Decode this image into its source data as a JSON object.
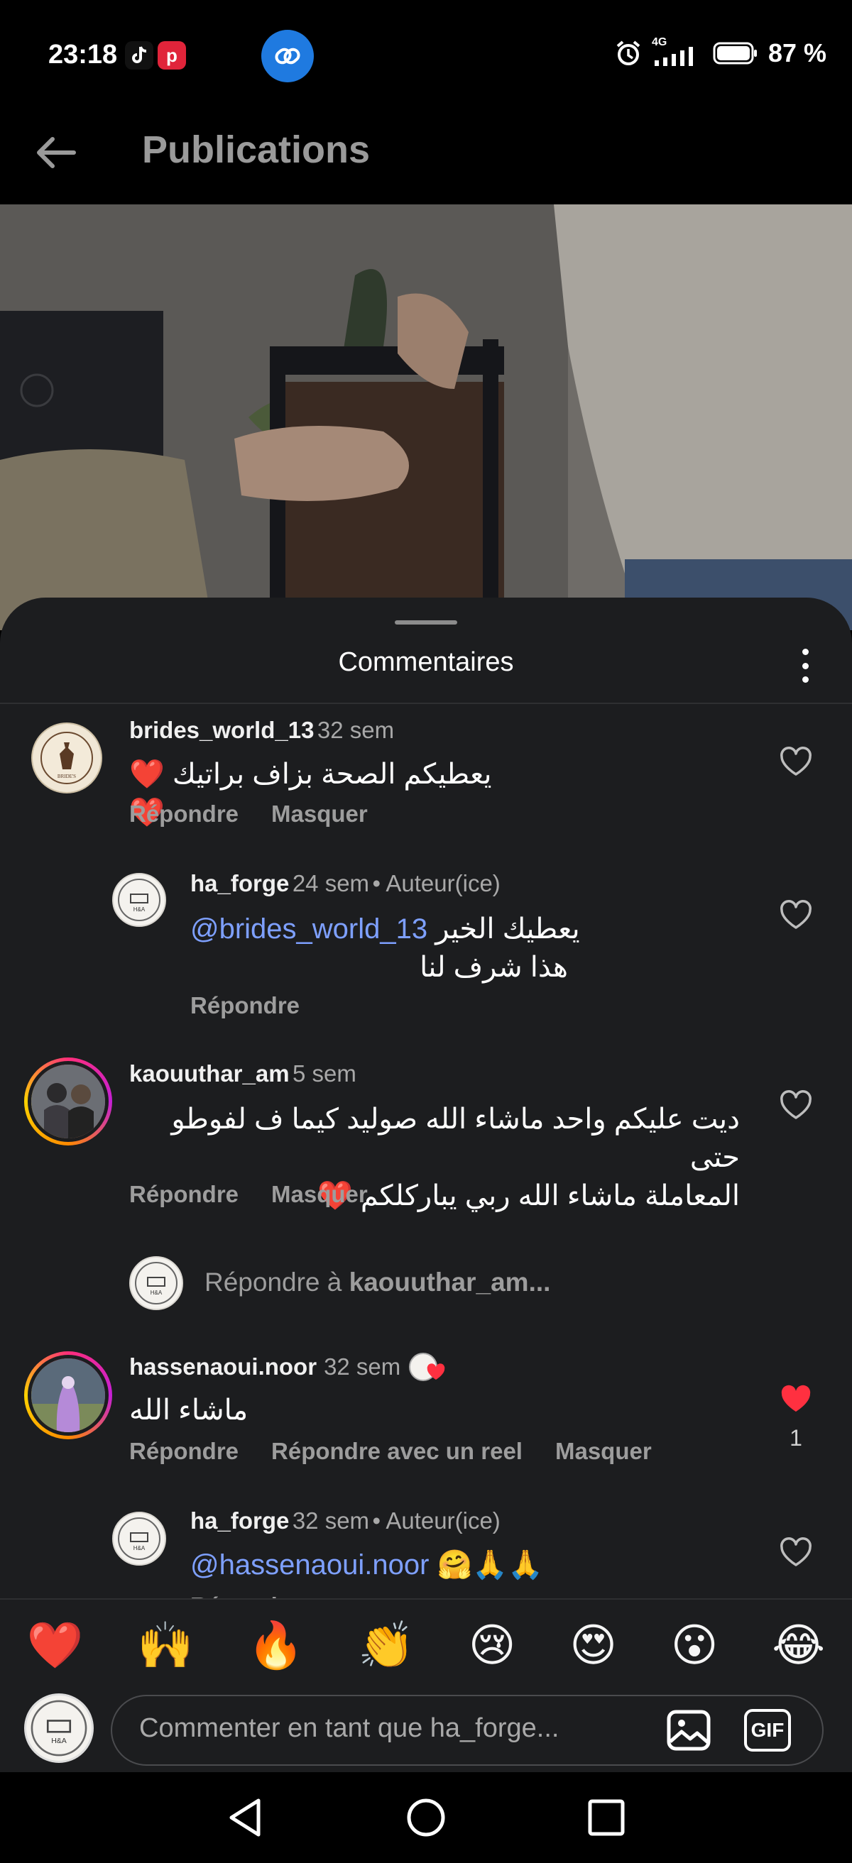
{
  "status_bar": {
    "time": "23:18",
    "network": "4G",
    "battery": "87 %",
    "icons": [
      "tiktok-icon",
      "red-app-icon",
      "link-icon",
      "alarm-icon",
      "signal-icon",
      "battery-icon"
    ]
  },
  "header": {
    "title": "Publications",
    "back_icon": "arrow-left-icon"
  },
  "sheet": {
    "title": "Commentaires",
    "menu_icon": "more-vertical-icon"
  },
  "comments": [
    {
      "username": "brides_world_13",
      "time": "32 sem",
      "text": "يعطيكم الصحة بزاف براتيك ❤️❤️",
      "actions": [
        "Répondre",
        "Masquer"
      ]
    },
    {
      "username": "ha_forge",
      "time": "24 sem",
      "author_badge": "• Auteur(ice)",
      "mention": "@brides_world_13",
      "text_line1": "يعطيك الخير",
      "text_line2": "هذا شرف لنا",
      "actions": [
        "Répondre"
      ]
    },
    {
      "username": "kaouuthar_am",
      "time": "5 sem",
      "text_line1": "ديت عليكم واحد ماشاء الله صوليد كيما ف لفوطو حتى",
      "text_line2": "المعاملة ماشاء الله ربي يباركلكم ❤️",
      "actions": [
        "Répondre",
        "Masquer"
      ]
    },
    {
      "username": "hassenaoui.noor",
      "time": "32 sem",
      "text": "ماشاء الله",
      "likes": "1",
      "actions": [
        "Répondre",
        "Répondre avec un reel",
        "Masquer"
      ]
    },
    {
      "username": "ha_forge",
      "time": "32 sem",
      "author_badge": "• Auteur(ice)",
      "mention": "@hassenaoui.noor",
      "text": "🤗🙏🙏",
      "actions": [
        "Répondre"
      ]
    }
  ],
  "reply_prompt": {
    "prefix": "Répondre à ",
    "username": "kaouuthar_am..."
  },
  "emoji_bar": [
    "❤️",
    "🙌",
    "🔥",
    "👏",
    "😢",
    "😍",
    "😮",
    "😂"
  ],
  "composer": {
    "placeholder": "Commenter en tant que ha_forge...",
    "gif_label": "GIF"
  },
  "colors": {
    "sheet_bg": "#1c1d1f",
    "mention": "#7ea0ff",
    "like_red": "#ff3040",
    "link_app_blue": "#1f7ae0"
  }
}
